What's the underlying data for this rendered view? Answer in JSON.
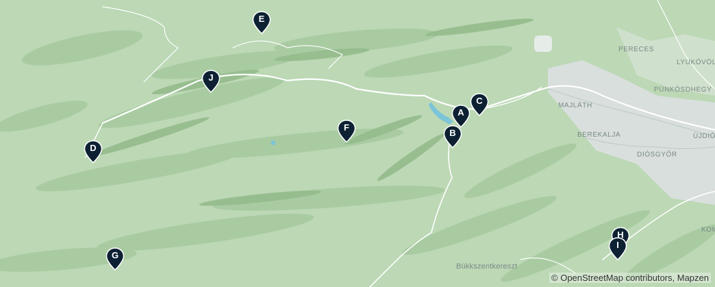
{
  "map": {
    "places": [
      {
        "key": "pereces",
        "label": "PERECES"
      },
      {
        "key": "lyukovolgy",
        "label": "LYUKÓVÖLGY"
      },
      {
        "key": "punkosdhegy",
        "label": "PÜNKÖSDHEGY"
      },
      {
        "key": "majlath",
        "label": "MAJLÁTH"
      },
      {
        "key": "berekalja",
        "label": "BEREKALJA"
      },
      {
        "key": "diosgyor",
        "label": "DIÓSGYŐR"
      },
      {
        "key": "ujdios",
        "label": "ÚJDIÓS"
      },
      {
        "key": "komi",
        "label": "KOMI"
      },
      {
        "key": "bukkszentkereszt",
        "label": "Bükkszentkereszt"
      }
    ],
    "markers": [
      "A",
      "B",
      "C",
      "D",
      "E",
      "F",
      "G",
      "H",
      "I",
      "J"
    ],
    "attribution": "© OpenStreetMap contributors, Mapzen",
    "colors": {
      "base": "#b9d6b3",
      "forest_dark": "#a4c69b",
      "ridge": "#93b98a",
      "urban": "#d9dedd",
      "road": "#ffffff",
      "water": "#78c3d9",
      "marker": "#0d2133"
    }
  }
}
